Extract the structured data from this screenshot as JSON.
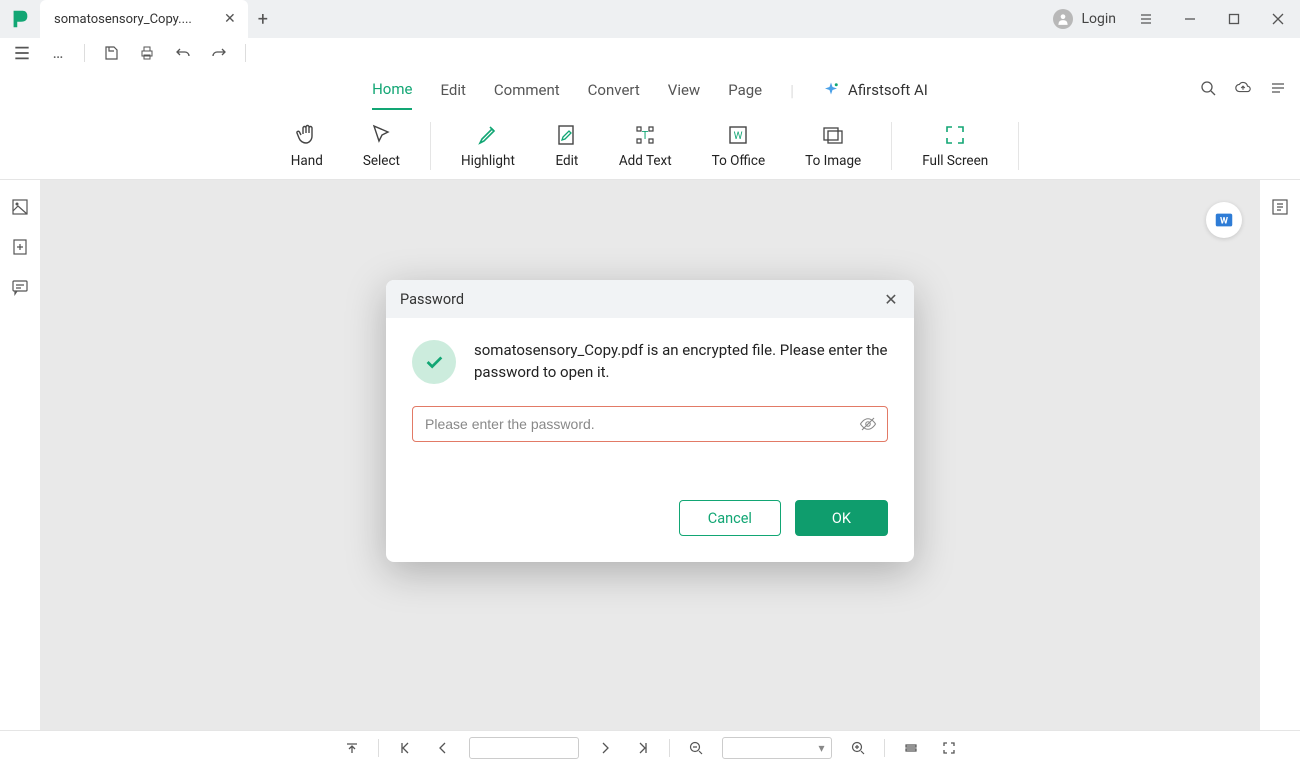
{
  "app": {
    "title": "somatosensory_Copy...."
  },
  "window": {
    "login": "Login"
  },
  "menu": {
    "items": [
      "Home",
      "Edit",
      "Comment",
      "Convert",
      "View",
      "Page"
    ],
    "active_index": 0,
    "ai_label": "Afirstsoft AI"
  },
  "toolbar": {
    "hand": "Hand",
    "select": "Select",
    "highlight": "Highlight",
    "edit": "Edit",
    "add_text": "Add Text",
    "to_office": "To Office",
    "to_image": "To Image",
    "full_screen": "Full Screen"
  },
  "dialog": {
    "title": "Password",
    "message": "somatosensory_Copy.pdf is an encrypted file. Please enter the password to open it.",
    "placeholder": "Please enter the password.",
    "cancel": "Cancel",
    "ok": "OK"
  },
  "colors": {
    "accent": "#12a674",
    "error_border": "#e27a66"
  }
}
